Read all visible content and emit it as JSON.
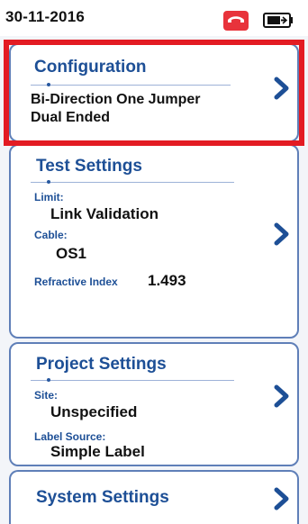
{
  "status_bar": {
    "date": "30-11-2016",
    "phone_icon": "phone-icon",
    "battery_icon": "battery-icon",
    "alert_color": "#e8333b"
  },
  "configuration": {
    "title": "Configuration",
    "line1": "Bi-Direction One Jumper",
    "line2": "Dual Ended"
  },
  "test_settings": {
    "title": "Test Settings",
    "limit_label": "Limit:",
    "limit_value": "Link Validation",
    "cable_label": "Cable:",
    "cable_value": "OS1",
    "refractive_label": "Refractive Index",
    "refractive_value": "1.493"
  },
  "project_settings": {
    "title": "Project Settings",
    "site_label": "Site:",
    "site_value": "Unspecified",
    "label_source_label": "Label Source:",
    "label_source_value": "Simple Label"
  },
  "system_settings": {
    "title": "System Settings"
  },
  "colors": {
    "accent": "#1d4f96",
    "highlight": "#e31b23"
  }
}
